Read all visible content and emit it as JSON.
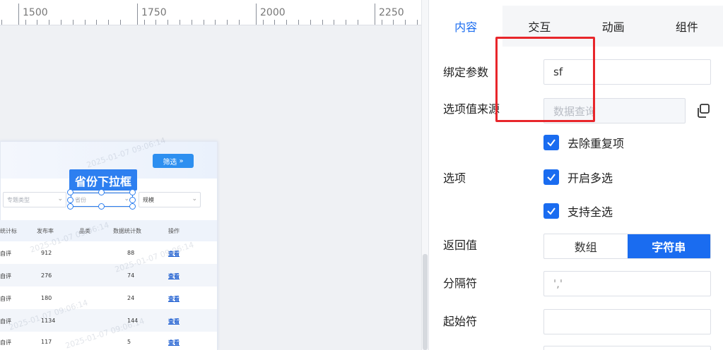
{
  "ruler": {
    "labels": [
      "1500",
      "1750",
      "2000",
      "2250"
    ]
  },
  "widget": {
    "filter_label": "筛选",
    "filter_icon": "chevron-down-double-icon",
    "selection_label": "省份下拉框",
    "dropdowns": [
      "专题类型",
      "省份",
      "规模"
    ],
    "watermark": "2025-01-07 09:06:14",
    "table": {
      "headers": [
        "统计标",
        "发布率",
        "品类",
        "数据统计数",
        "操作"
      ],
      "rows": [
        {
          "c1": "自评",
          "c2": "912",
          "c4": "88",
          "action": "查看"
        },
        {
          "c1": "自评",
          "c2": "276",
          "c4": "74",
          "action": "查看"
        },
        {
          "c1": "自评",
          "c2": "180",
          "c4": "24",
          "action": "查看"
        },
        {
          "c1": "自评",
          "c2": "1134",
          "c4": "144",
          "action": "查看"
        },
        {
          "c1": "自评",
          "c2": "117",
          "c4": "5",
          "action": "查看"
        }
      ]
    }
  },
  "panel": {
    "tabs": [
      {
        "label": "内容",
        "active": true
      },
      {
        "label": "交互",
        "active": false
      },
      {
        "label": "动画",
        "active": false
      },
      {
        "label": "组件",
        "active": false
      }
    ],
    "bind_param": {
      "label": "绑定参数",
      "value": "sf"
    },
    "option_source": {
      "label": "选项值来源",
      "placeholder": "数据查询"
    },
    "options": {
      "label": "选项",
      "items": [
        {
          "label": "去除重复项",
          "checked": true
        },
        {
          "label": "开启多选",
          "checked": true
        },
        {
          "label": "支持全选",
          "checked": true
        }
      ]
    },
    "return_value": {
      "label": "返回值",
      "options": [
        "数组",
        "字符串"
      ],
      "selected": "字符串"
    },
    "separator": {
      "label": "分隔符",
      "value": "','"
    },
    "start_char": {
      "label": "起始符",
      "value": ""
    }
  },
  "colors": {
    "accent": "#1a6cf0",
    "highlight_box": "#e8262b"
  }
}
